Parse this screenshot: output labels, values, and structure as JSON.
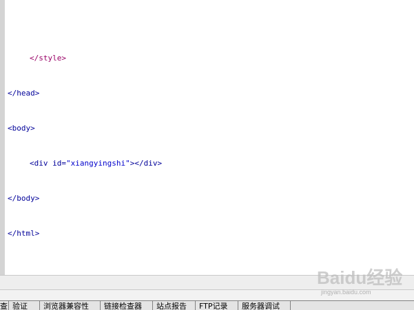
{
  "editor": {
    "lines": [
      {
        "indent": true,
        "text": "</style>",
        "kind": "style"
      },
      {
        "indent": false,
        "text": "</head>",
        "kind": "tag"
      },
      {
        "indent": false,
        "text": "<body>",
        "kind": "tag"
      },
      {
        "indent": true,
        "pre": "<div id=",
        "val": "\"xiangyingshi\"",
        "post": "></div>",
        "kind": "div"
      },
      {
        "indent": false,
        "text": "</body>",
        "kind": "tag"
      },
      {
        "indent": false,
        "text": "</html>",
        "kind": "tag"
      }
    ]
  },
  "bottom_tabs": [
    {
      "label": "查"
    },
    {
      "label": "验证"
    },
    {
      "label": "浏览器兼容性"
    },
    {
      "label": "链接检查器"
    },
    {
      "label": "站点报告"
    },
    {
      "label": "FTP记录"
    },
    {
      "label": "服务器调试"
    }
  ],
  "watermark": {
    "logo": "Baidu经验",
    "url": "jingyan.baidu.com"
  },
  "colors": {
    "style_tag": "#990066",
    "tag": "#000099",
    "attr_value": "#0000cc",
    "gutter": "#d4d4d4"
  }
}
